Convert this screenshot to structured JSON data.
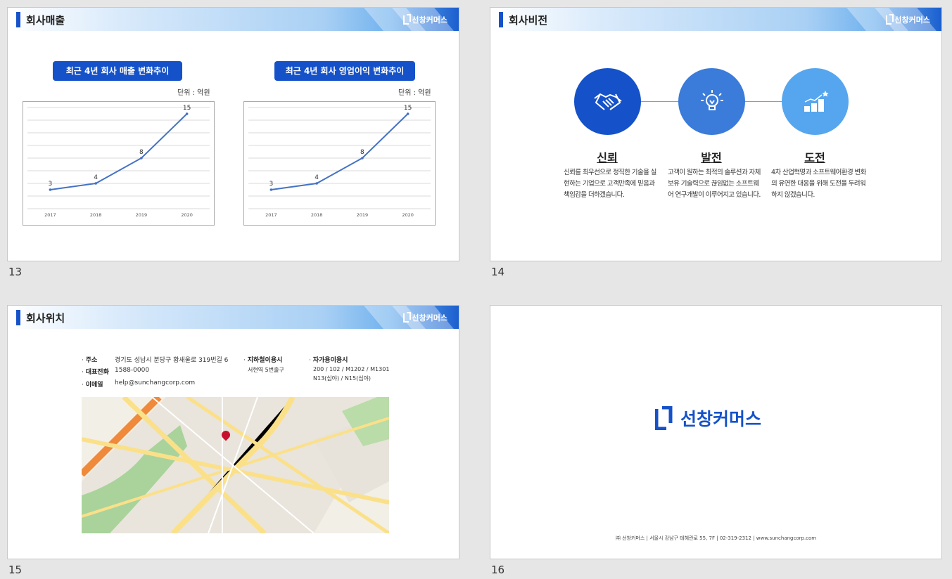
{
  "brand": "선창커머스",
  "slides": [
    {
      "number": "13",
      "title": "회사매출",
      "charts_labels": [
        "최근 4년 회사 매출 변화추이",
        "최근 4년 회사 영업이익 변화추이"
      ],
      "unit": "단위 : 억원"
    },
    {
      "number": "14",
      "title": "회사비전",
      "values": [
        {
          "icon": "handshake-icon",
          "color": "#1552c9",
          "heading": "신뢰",
          "text": "신뢰를 최우선으로 정직한 기술을 실현하는 기업으로 고객만족에 믿음과 책임감을 더하겠습니다."
        },
        {
          "icon": "lightbulb-icon",
          "color": "#3b7bd9",
          "heading": "발전",
          "text": "고객이 원하는 최적의 솔루션과 자체 보유 기술력으로 끊임없는 소프트웨어 연구개발이 이루어지고 있습니다."
        },
        {
          "icon": "growth-chart-icon",
          "color": "#55a6ee",
          "heading": "도전",
          "text": "4차 산업혁명과 소프트웨어환경 변화의 유연한 대응을 위해 도전을 두려워하지 않겠습니다."
        }
      ]
    },
    {
      "number": "15",
      "title": "회사위치",
      "info": {
        "address_label": "주소",
        "address": "경기도 성남시 분당구 황새울로 319번길 6",
        "phone_label": "대표전화",
        "phone": "1588-0000",
        "email_label": "이메일",
        "email": "help@sunchangcorp.com",
        "subway_label": "지하철이용시",
        "subway": "서현역 5번출구",
        "car_label": "자가용이용시",
        "car_line1": "200 / 102 / M1202 / M1301",
        "car_line2": "N13(심야) / N15(심야)"
      }
    },
    {
      "number": "16",
      "logo_text": "선창커머스",
      "footer": "㈜ 선창커머스 | 서울시 강남구 테헤란로 55, 7F | 02-319-2312 | www.sunchangcorp.com"
    }
  ],
  "chart_data": [
    {
      "type": "line",
      "title": "최근 4년 회사 매출 변화추이",
      "categories": [
        "2017",
        "2018",
        "2019",
        "2020"
      ],
      "values": [
        3,
        4,
        8,
        15
      ],
      "ylabel": "단위 : 억원",
      "ylim": [
        0,
        16
      ],
      "grid": true,
      "color": "#4472c4"
    },
    {
      "type": "line",
      "title": "최근 4년 회사 영업이익 변화추이",
      "categories": [
        "2017",
        "2018",
        "2019",
        "2020"
      ],
      "values": [
        3,
        4,
        8,
        15
      ],
      "ylabel": "단위 : 억원",
      "ylim": [
        0,
        16
      ],
      "grid": true,
      "color": "#4472c4"
    }
  ]
}
